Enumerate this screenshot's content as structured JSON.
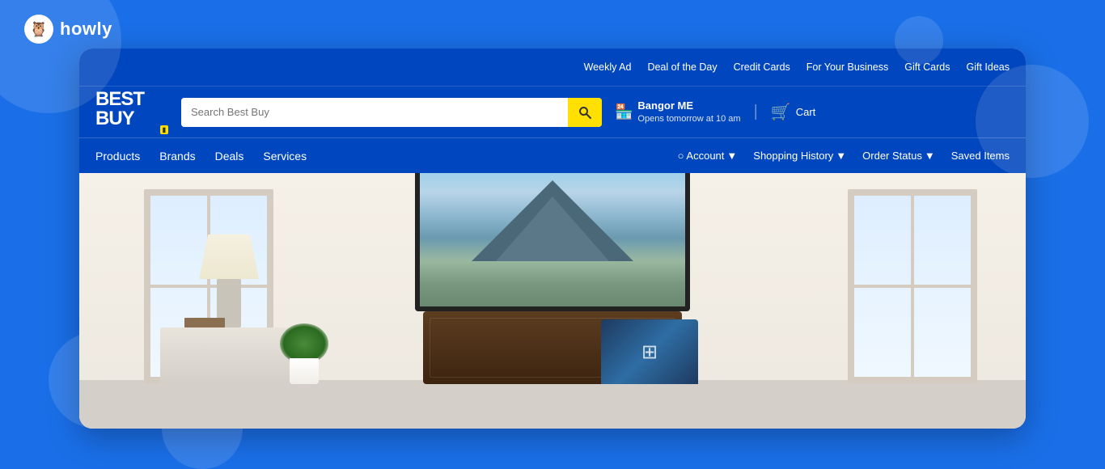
{
  "howly": {
    "logo_emoji": "🦉",
    "brand": "howly"
  },
  "bestbuy": {
    "logo_line1": "BEST",
    "logo_line2": "BUY",
    "logo_tag": "®",
    "topnav": {
      "items": [
        {
          "id": "weekly-ad",
          "label": "Weekly Ad"
        },
        {
          "id": "deal-of-the-day",
          "label": "Deal of the Day"
        },
        {
          "id": "credit-cards",
          "label": "Credit Cards"
        },
        {
          "id": "for-your-business",
          "label": "For Your Business"
        },
        {
          "id": "gift-cards",
          "label": "Gift Cards"
        },
        {
          "id": "gift-ideas",
          "label": "Gift Ideas"
        }
      ]
    },
    "search": {
      "placeholder": "Search Best Buy"
    },
    "store": {
      "icon": "🏪",
      "location": "Bangor ME",
      "hours": "Opens tomorrow at 10 am"
    },
    "cart": {
      "icon": "🛒",
      "label": "Cart"
    },
    "secondnav": {
      "left": [
        {
          "id": "products",
          "label": "Products"
        },
        {
          "id": "brands",
          "label": "Brands"
        },
        {
          "id": "deals",
          "label": "Deals"
        },
        {
          "id": "services",
          "label": "Services"
        }
      ],
      "right": [
        {
          "id": "account",
          "label": "Account",
          "has_dropdown": true
        },
        {
          "id": "shopping-history",
          "label": "Shopping History",
          "has_dropdown": true
        },
        {
          "id": "order-status",
          "label": "Order Status",
          "has_dropdown": true
        },
        {
          "id": "saved-items",
          "label": "Saved Items",
          "has_dropdown": false
        }
      ]
    }
  },
  "colors": {
    "bb_blue": "#0046be",
    "bb_yellow": "#ffe000",
    "bg_blue": "#1a6fe8"
  }
}
